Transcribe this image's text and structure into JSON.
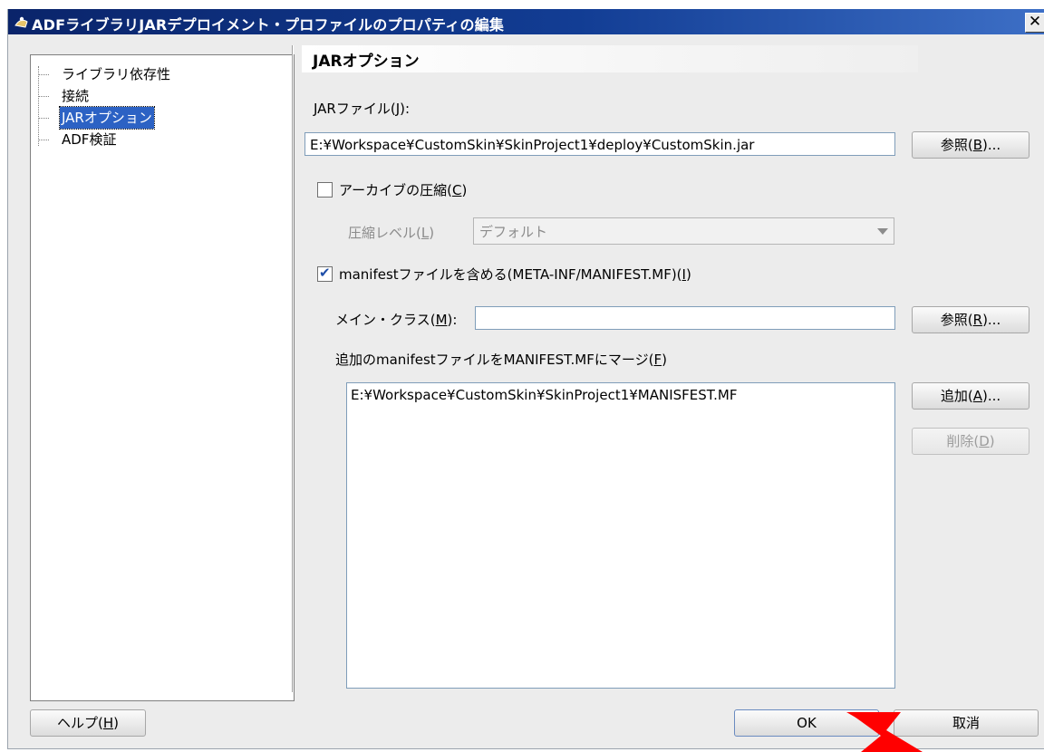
{
  "window": {
    "title": "ADFライブラリJARデプロイメント・プロファイルのプロパティの編集"
  },
  "tree": {
    "items": [
      {
        "label": "ライブラリ依存性"
      },
      {
        "label": "接続"
      },
      {
        "label": "JARオプション"
      },
      {
        "label": "ADF検証"
      }
    ]
  },
  "section": {
    "title": "JARオプション"
  },
  "jar_file": {
    "label_prefix": "JARファイル(",
    "label_key": "J",
    "label_suffix": "):",
    "value": "E:¥Workspace¥CustomSkin¥SkinProject1¥deploy¥CustomSkin.jar",
    "browse_prefix": "参照(",
    "browse_key": "B",
    "browse_suffix": ")..."
  },
  "compress": {
    "label_prefix": "アーカイブの圧縮(",
    "label_key": "C",
    "label_suffix": ")",
    "level_prefix": "圧縮レベル(",
    "level_key": "L",
    "level_suffix": ")",
    "level_value": "デフォルト"
  },
  "manifest": {
    "label_prefix": "manifestファイルを含める(META-INF/MANIFEST.MF)(",
    "label_key": "I",
    "label_suffix": ")",
    "main_class_prefix": "メイン・クラス(",
    "main_class_key": "M",
    "main_class_suffix": "):",
    "main_class_value": "",
    "browse_prefix": "参照(",
    "browse_key": "R",
    "browse_suffix": ")...",
    "merge_prefix": "追加のmanifestファイルをMANIFEST.MFにマージ(",
    "merge_key": "F",
    "merge_suffix": ")",
    "merge_files": [
      "E:¥Workspace¥CustomSkin¥SkinProject1¥MANISFEST.MF"
    ],
    "add_prefix": "追加(",
    "add_key": "A",
    "add_suffix": ")...",
    "remove_prefix": "削除(",
    "remove_key": "D",
    "remove_suffix": ")"
  },
  "footer": {
    "help_prefix": "ヘルプ(",
    "help_key": "H",
    "help_suffix": ")",
    "ok_label": "OK",
    "cancel_label": "取消"
  },
  "colors": {
    "titlebar": "#0a246a",
    "selection": "#2c62c4",
    "annotation_arrow": "#ff0000"
  }
}
